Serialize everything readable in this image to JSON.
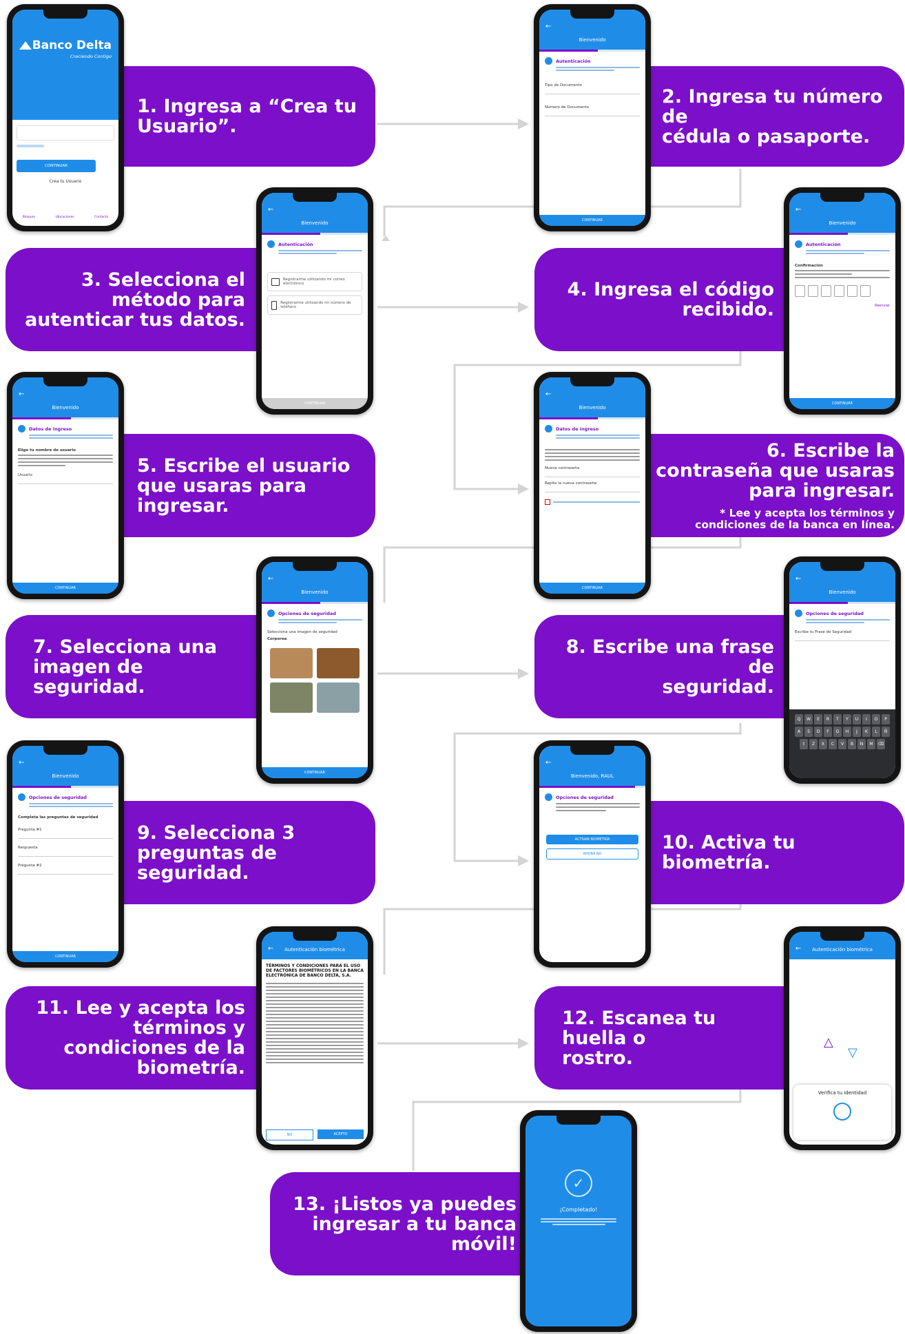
{
  "brand": {
    "name": "Banco Delta",
    "tagline": "Creciendo Contigo"
  },
  "steps": [
    {
      "num": 1,
      "text": "1. Ingresa a “Crea tu\nUsuario”."
    },
    {
      "num": 2,
      "text": "2. Ingresa tu número de\ncédula o pasaporte."
    },
    {
      "num": 3,
      "text": "3. Selecciona el\nmétodo para\nautenticar tus datos."
    },
    {
      "num": 4,
      "text": "4. Ingresa el código\nrecibido."
    },
    {
      "num": 5,
      "text": "5. Escribe el usuario\nque usaras para\ningresar."
    },
    {
      "num": 6,
      "text": "6. Escribe la\ncontraseña que usaras\npara ingresar.",
      "note": "* Lee y acepta los términos y\ncondiciones de la banca en línea."
    },
    {
      "num": 7,
      "text": "7. Selecciona una\nimagen de seguridad."
    },
    {
      "num": 8,
      "text": "8. Escribe una frase de\nseguridad."
    },
    {
      "num": 9,
      "text": "9. Selecciona 3\npreguntas de\nseguridad."
    },
    {
      "num": 10,
      "text": "10. Activa tu biometría."
    },
    {
      "num": 11,
      "text": "11. Lee y acepta los\ntérminos y\ncondiciones de la\nbiometría."
    },
    {
      "num": 12,
      "text": "12. Escanea tu huella o\nrostro."
    },
    {
      "num": 13,
      "text": "13. ¡Listos ya puedes\ningresar a tu banca\nmóvil!"
    }
  ],
  "phones": {
    "welcome": "Bienvenido",
    "auth_title": "Autenticación",
    "login_title": "Datos de ingreso",
    "security_title": "Opciones de seguridad",
    "security_image_label": "Selecciona una imagen de seguridad",
    "security_image_value": "Corporea",
    "phrase_label": "Escribe tu Frase de Seguridad",
    "questions_label": "Completa las preguntas de seguridad",
    "question1_label": "Pregunta #1",
    "answer_label": "Respuesta",
    "question2_label": "Pregunta #2",
    "confirm_label": "Confirmación",
    "doc_type_label": "Tipo de Documento",
    "doc_number_label": "Número de Documento",
    "username_label": "Elige tu nombre de usuario",
    "user_label": "Usuario",
    "new_password_label": "Nueva contraseña",
    "repeat_password_label": "Repite la nueva contraseña",
    "resend_label": "Reenviar",
    "email_option": "Registrarme utilizando mi correo electrónico",
    "sms_option": "Registrarme utilizando mi número de teléfono",
    "continue_button": "CONTINUAR",
    "create_user_link": "Crea tu Usuario",
    "biometrics_header": "Autenticación biométrica",
    "terms_title": "TÉRMINOS Y CONDICIONES PARA EL USO DE FACTORES BIOMÉTRICOS EN LA BANCA ELECTRÓNICA DE BANCO DELTA, S.A.",
    "no_button": "NO",
    "accept_button": "ACEPTO",
    "verify_label": "Verifica tu identidad",
    "activate_biometrics_button": "ACTIVAR BIOMETRÍA",
    "not_now_button": "AHORA NO",
    "completed_label": "¡Completado!",
    "welcome_named": "Bienvenido, RAUL",
    "nav_labels": [
      "Bloqueo",
      "Ubicaciones",
      "Contacto"
    ]
  },
  "colors": {
    "accent": "#7c0fc9",
    "app_blue": "#1f8de8",
    "connector": "#d3d3d3"
  }
}
